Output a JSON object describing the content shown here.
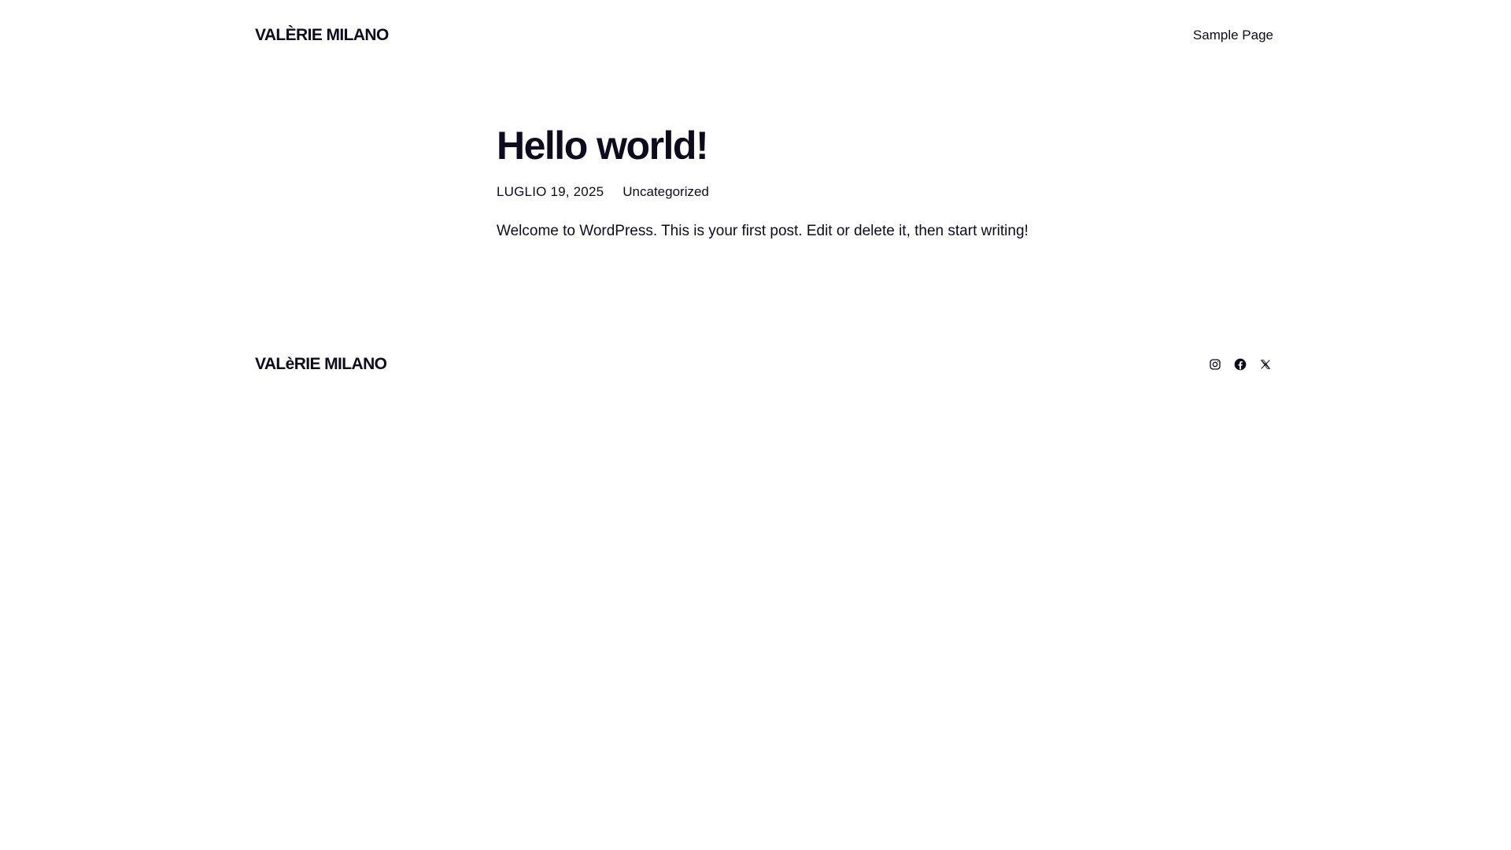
{
  "header": {
    "site_title": "VALÈRIE MILANO",
    "nav": [
      {
        "label": "Sample Page"
      }
    ]
  },
  "post": {
    "title": "Hello world!",
    "date": "LUGLIO 19, 2025",
    "category": "Uncategorized",
    "content": "Welcome to WordPress. This is your first post. Edit or delete it, then start writing!"
  },
  "footer": {
    "site_title": "VALèRIE MILANO",
    "social": [
      {
        "icon": "instagram-icon"
      },
      {
        "icon": "facebook-icon"
      },
      {
        "icon": "x-icon"
      }
    ]
  },
  "colors": {
    "text": "#0f0b1e",
    "background": "#ffffff"
  }
}
